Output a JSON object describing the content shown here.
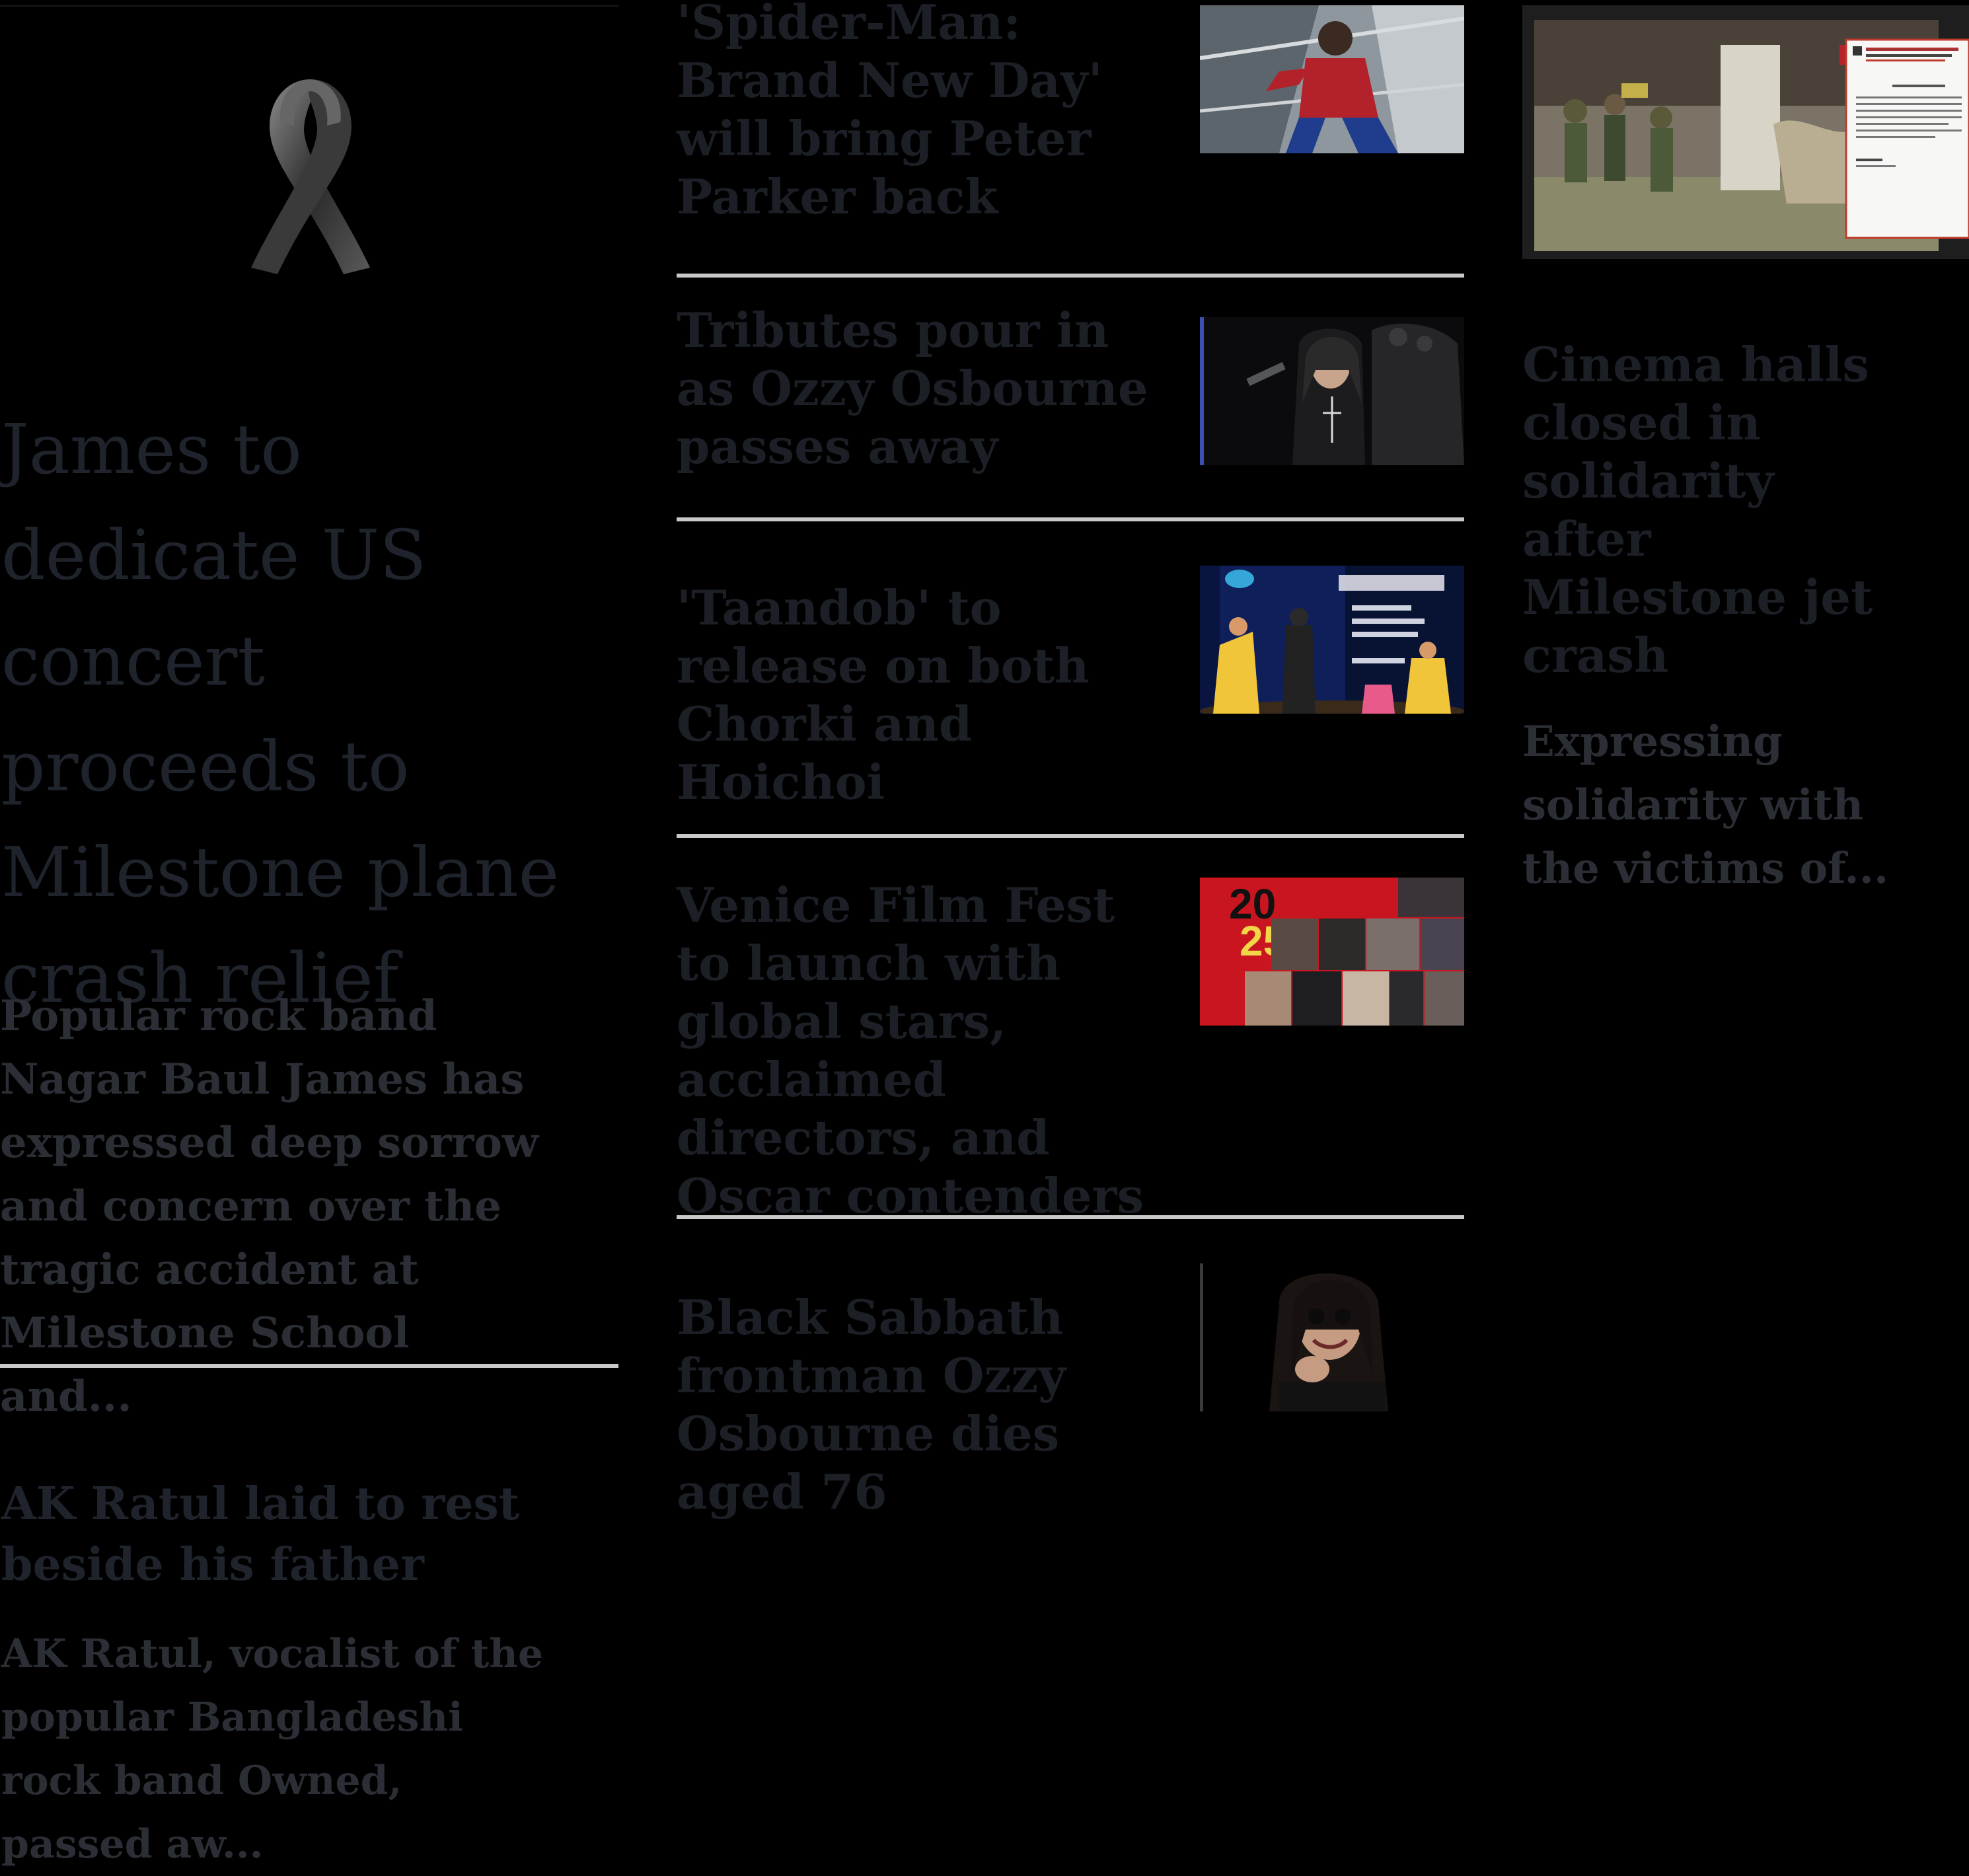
{
  "lead": {
    "image": "black-ribbon-icon",
    "headline": "James to dedicate US concert proceeds to Milestone plane crash relief",
    "summary": "Popular rock band Nagar Baul James has expressed deep sorrow and concern over the tragic accident at Milestone School and..."
  },
  "second": {
    "headline": "AK Ratul laid to rest beside his father",
    "summary": "AK Ratul, vocalist of the popular Bangladeshi rock band Owned, passed aw..."
  },
  "middle": {
    "stories": [
      {
        "headline": "'Spider-Man: Brand New Day' will bring Peter Parker back",
        "thumb": "spider-man-photo"
      },
      {
        "headline": "Tributes pour in as Ozzy Osbourne passes away",
        "thumb": "ozzy-throne-photo"
      },
      {
        "headline": "'Taandob' to release on both Chorki and Hoichoi",
        "thumb": "taandob-stage-photo"
      },
      {
        "headline": "Venice Film Fest to launch with global stars, acclaimed directors, and Oscar contenders",
        "thumb": "venice-collage-photo"
      },
      {
        "headline": "Black Sabbath frontman Ozzy Osbourne dies aged 76",
        "thumb": "ozzy-portrait-photo"
      }
    ]
  },
  "venice_thumb": {
    "year_top": "20",
    "year_bottom": "25"
  },
  "right": {
    "image": "crash-site-with-notice-photo",
    "headline": "Cinema halls closed in solidarity after Milestone jet crash",
    "summary": "Expressing solidarity with the victims of..."
  },
  "colors": {
    "background": "#000000",
    "headline": "#1f232c",
    "body_text": "#2b2e35",
    "divider": "#c9c9c9"
  }
}
